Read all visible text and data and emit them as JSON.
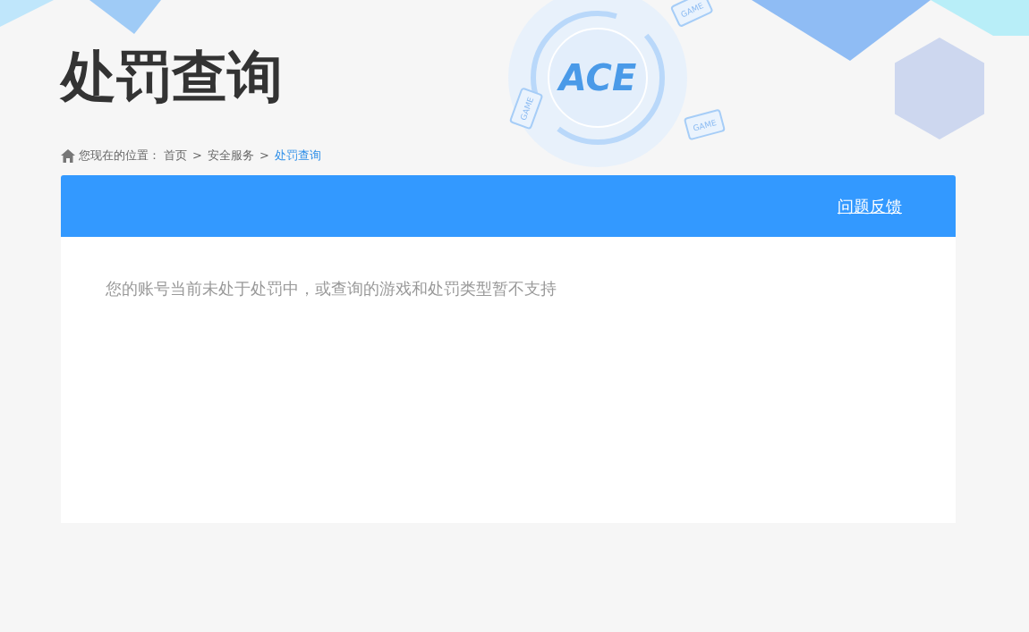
{
  "page_title": "处罚查询",
  "logo": {
    "text": "ACE",
    "device_labels": [
      "GAME",
      "GAME",
      "GAME"
    ]
  },
  "breadcrumb": {
    "prefix": "您现在的位置：",
    "items": [
      {
        "label": "首页",
        "current": false
      },
      {
        "label": "安全服务",
        "current": false
      },
      {
        "label": "处罚查询",
        "current": true
      }
    ],
    "separator": ">"
  },
  "panel": {
    "feedback_link": "问题反馈",
    "message": "您的账号当前未处于处罚中，或查询的游戏和处罚类型暂不支持"
  }
}
